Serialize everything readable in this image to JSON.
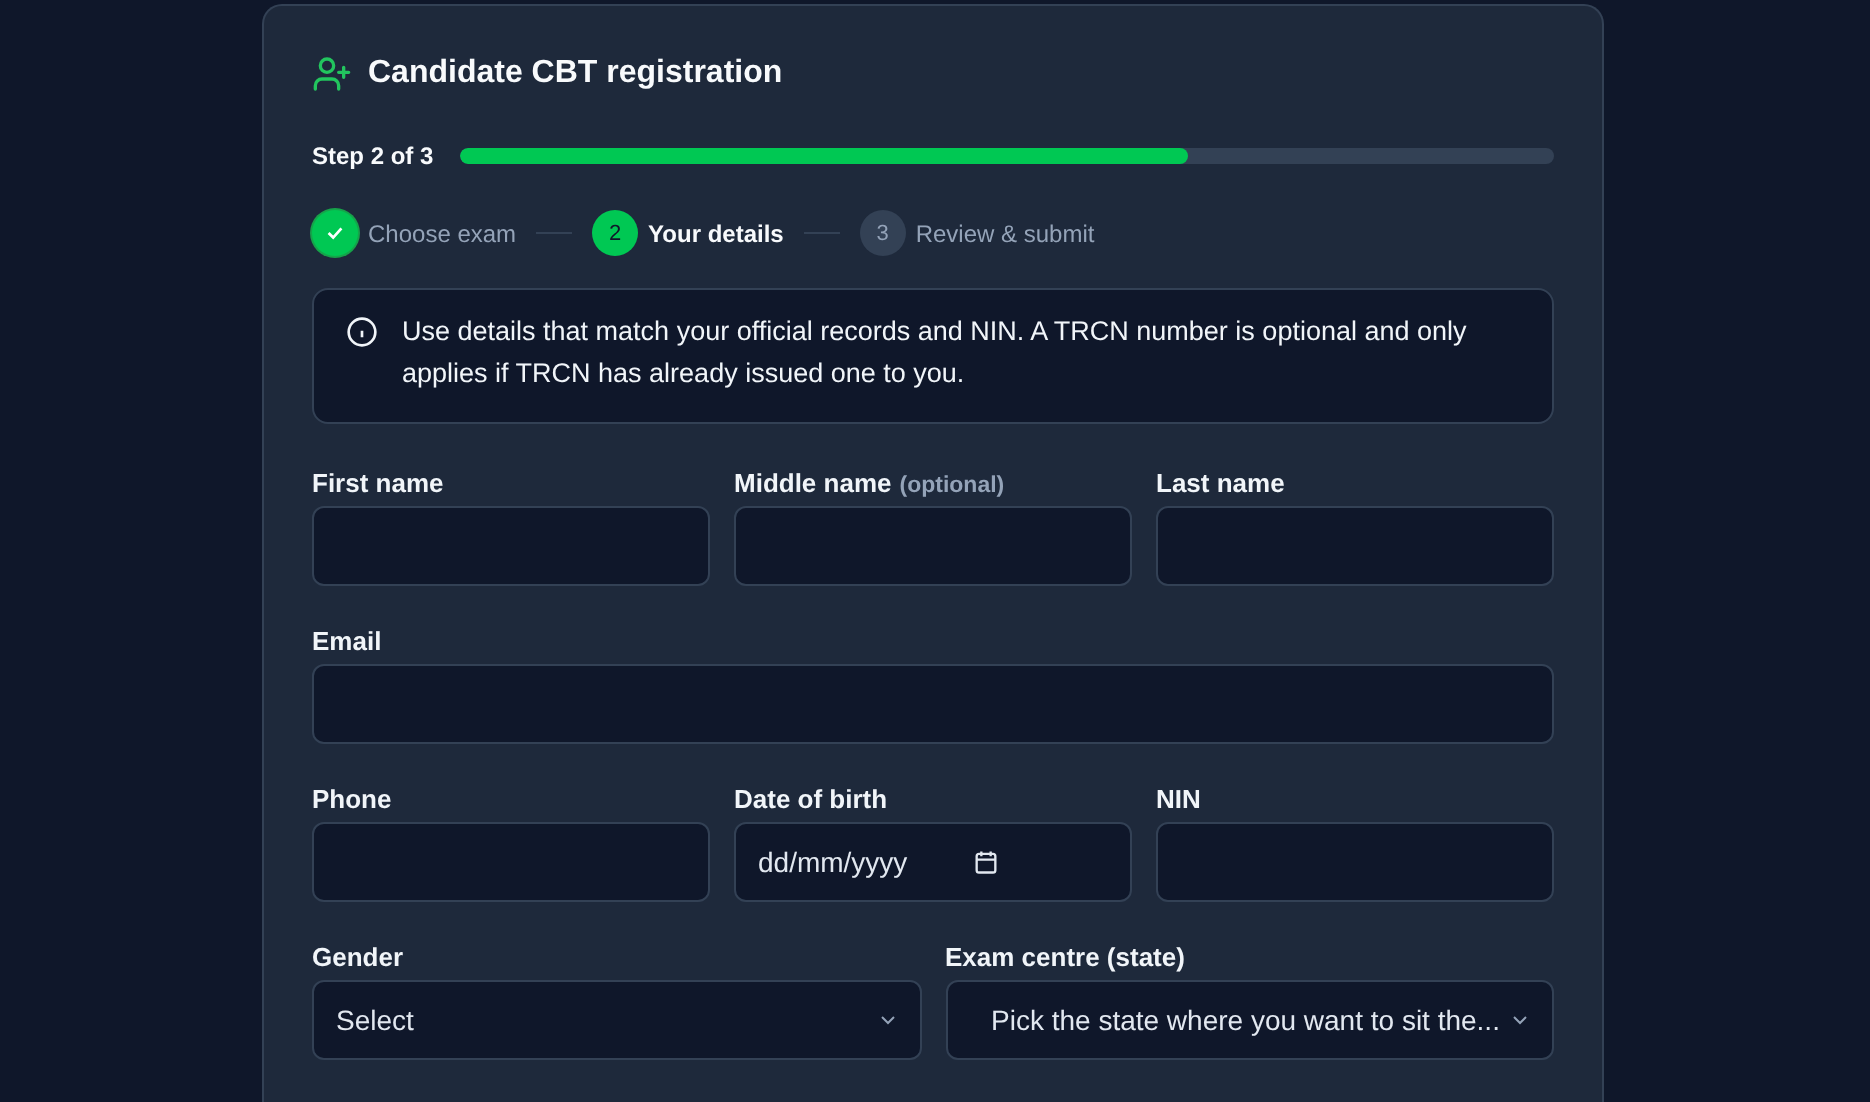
{
  "card": {
    "title": "Candidate CBT registration",
    "progress": {
      "label": "Step 2 of 3",
      "level": 0.666
    },
    "steps": [
      {
        "label": "Choose exam",
        "completed": true,
        "selected": false
      },
      {
        "number": "2",
        "label": "Your details",
        "completed": false,
        "selected": true
      },
      {
        "number": "3",
        "label": "Review & submit",
        "completed": false,
        "selected": false
      }
    ],
    "notice": "Use details that match your official records and NIN. A TRCN number is optional and only applies if TRCN has already issued one to you.",
    "rows": [
      [
        {
          "kind": "text",
          "label": "First name"
        },
        {
          "kind": "text",
          "label": "Middle name",
          "note": "(optional)"
        },
        {
          "kind": "text",
          "label": "Last name"
        }
      ],
      [
        {
          "kind": "text",
          "label": "Email"
        }
      ],
      [
        {
          "kind": "text",
          "label": "Phone"
        },
        {
          "kind": "date",
          "label": "Date of birth",
          "placeholder": "dd/mm/yyyy"
        },
        {
          "kind": "text",
          "label": "NIN"
        }
      ],
      [
        {
          "kind": "select",
          "label": "Gender",
          "value": "Select"
        },
        {
          "kind": "select",
          "label": "Exam centre (state)",
          "value": "Pick the state where you want to sit the...",
          "indented": true
        }
      ]
    ]
  }
}
